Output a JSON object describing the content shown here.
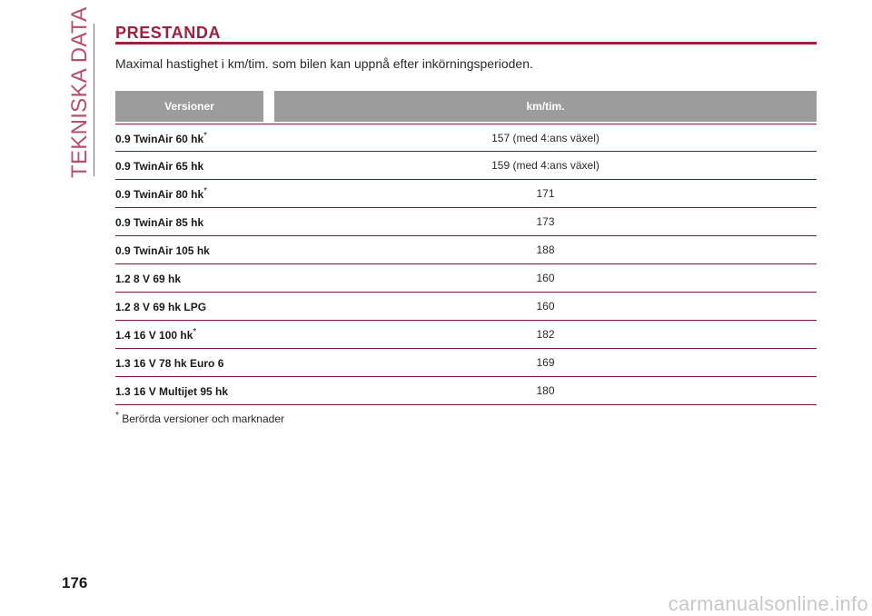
{
  "side_tab": {
    "label": "TEKNISKA DATA"
  },
  "section": {
    "title": "PRESTANDA",
    "intro": "Maximal hastighet i km/tim. som bilen kan uppnå efter inkörningsperioden."
  },
  "table": {
    "headers": {
      "version": "Versioner",
      "speed": "km/tim."
    },
    "rows": [
      {
        "version": "0.9 TwinAir 60 hk",
        "mark": "*",
        "speed": "157 (med 4:ans växel)"
      },
      {
        "version": "0.9 TwinAir 65 hk",
        "mark": "",
        "speed": "159 (med 4:ans växel)"
      },
      {
        "version": "0.9 TwinAir 80 hk",
        "mark": "*",
        "speed": "171"
      },
      {
        "version": "0.9 TwinAir 85 hk",
        "mark": "",
        "speed": "173"
      },
      {
        "version": "0.9 TwinAir 105 hk",
        "mark": "",
        "speed": "188"
      },
      {
        "version": "1.2 8 V 69 hk",
        "mark": "",
        "speed": "160"
      },
      {
        "version": "1.2 8 V 69 hk LPG",
        "mark": "",
        "speed": "160"
      },
      {
        "version": "1.4 16 V 100 hk",
        "mark": "*",
        "speed": "182"
      },
      {
        "version": "1.3 16 V 78 hk Euro 6",
        "mark": "",
        "speed": "169"
      },
      {
        "version": "1.3 16 V Multijet 95 hk",
        "mark": "",
        "speed": "180"
      }
    ]
  },
  "footnote": {
    "mark": "*",
    "text": "Berörda versioner och marknader"
  },
  "page_number": "176",
  "watermark": "carmanualsonline.info",
  "colors": {
    "accent": "#a01e3e",
    "side_tab": "#b4506c",
    "header_bg": "#9c9c9c",
    "row_rule": "#7a1630"
  }
}
